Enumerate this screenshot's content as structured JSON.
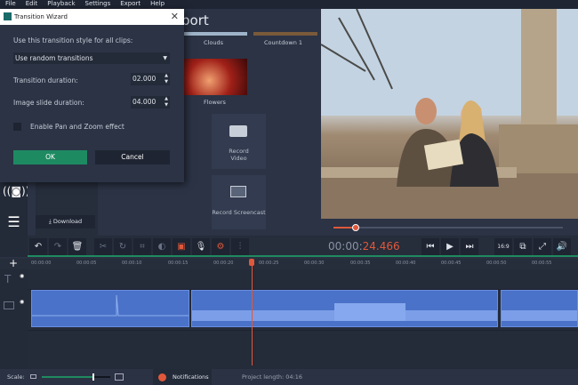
{
  "menu": [
    "File",
    "Edit",
    "Playback",
    "Settings",
    "Export",
    "Help"
  ],
  "dialog": {
    "title": "Transition Wizard",
    "style_label": "Use this transition style for all clips:",
    "style_value": "Use random transitions",
    "transition_label": "Transition duration:",
    "transition_value": "02.000",
    "slide_label": "Image slide duration:",
    "slide_value": "04.000",
    "panzoom_label": "Enable Pan and Zoom effect",
    "panzoom_checked": false,
    "ok": "OK",
    "cancel": "Cancel"
  },
  "center": {
    "heading_partial": "port",
    "items": [
      "Clouds",
      "Countdown 1",
      "Flowers"
    ],
    "record_video": "Record Video",
    "record_screencast": "Record Screencast",
    "download": "Download"
  },
  "player": {
    "time_prefix": "00:00:",
    "time_value": "24.466",
    "aspect": "16:9",
    "progress": 0.14
  },
  "ruler": [
    "00:00:00",
    "00:00:05",
    "00:00:10",
    "00:00:15",
    "00:00:20",
    "00:00:25",
    "00:00:30",
    "00:00:35",
    "00:00:40",
    "00:00:45",
    "00:00:50",
    "00:00:55"
  ],
  "status": {
    "scale_label": "Scale:",
    "scale_value": 0.75,
    "notifications": "Notifications",
    "project_length_label": "Project length:",
    "project_length": "04:16"
  },
  "colors": {
    "accent": "#1f8a5f",
    "time": "#e0583a",
    "clip": "#4a72c8"
  }
}
